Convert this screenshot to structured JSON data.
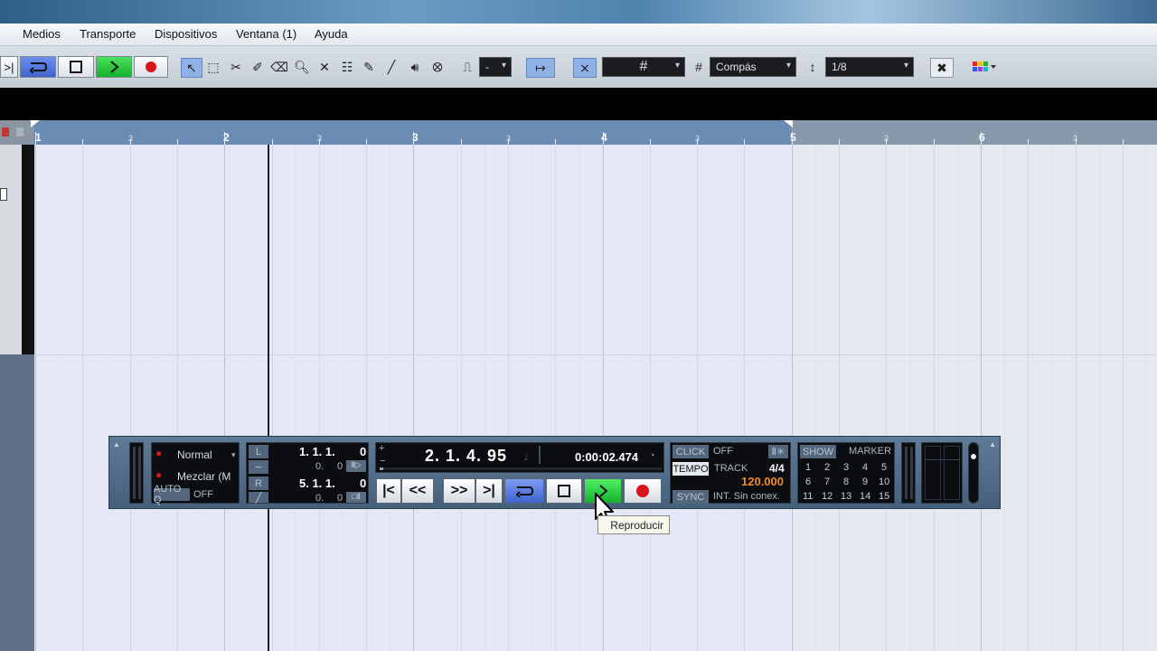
{
  "menu": {
    "items": [
      "Medios",
      "Transporte",
      "Dispositivos",
      "Ventana (1)",
      "Ayuda"
    ]
  },
  "toolbar": {
    "quantize_value": "-",
    "grid_label": "Compás",
    "quantize_label": "1/8"
  },
  "ruler": {
    "bars": [
      "1",
      "2",
      "3",
      "4",
      "5",
      "6"
    ],
    "sub_label": "3"
  },
  "transport": {
    "mode_label": "Normal",
    "mix_label": "Mezclar (M",
    "autoq_label": "AUTO Q",
    "autoq_value": "OFF",
    "left_locator": "1. 1. 1.",
    "left_locator_tick": "0",
    "left_sub": "0.",
    "left_sub_tick": "0",
    "right_locator": "5. 1. 1.",
    "right_locator_tick": "0",
    "right_sub": "0.",
    "right_sub_tick": "0",
    "position_bars": "2. 1. 4. 95",
    "position_time": "0:00:02.474",
    "click_label": "CLICK",
    "click_value": "OFF",
    "tempo_label": "TEMPO",
    "tempo_mode": "TRACK",
    "signature": "4/4",
    "tempo_value": "120.000",
    "sync_label": "SYNC",
    "sync_value": "INT. Sin conex.",
    "show_label": "SHOW",
    "marker_label": "MARKER",
    "markers_row1": [
      "1",
      "2",
      "3",
      "4",
      "5"
    ],
    "markers_row2": [
      "6",
      "7",
      "8",
      "9",
      "10"
    ],
    "markers_row3": [
      "11",
      "12",
      "13",
      "14",
      "15"
    ]
  },
  "tooltip": "Reproducir",
  "colors": {
    "play_green": "#1ec83a",
    "record_red": "#d8141e",
    "cycle_blue": "#4a6fd8",
    "tempo_orange": "#f08b2c",
    "ruler_blue": "#6a8cb4"
  }
}
